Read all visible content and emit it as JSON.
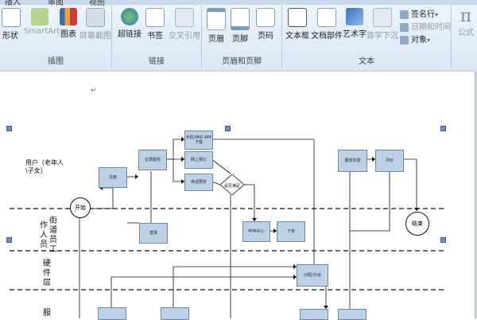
{
  "ribbon": {
    "tabs": [
      "插入",
      "审阅",
      "视图"
    ],
    "groups": [
      {
        "label": "插图"
      },
      {
        "label": "链接"
      },
      {
        "label": "页眉和页脚"
      },
      {
        "label": "文本"
      }
    ],
    "buttons": {
      "shape": "形状",
      "smartart": "SmartArt",
      "chart": "图表",
      "screenshot": "屏幕截图",
      "hyperlink": "超链接",
      "bookmark": "书签",
      "crossref": "交叉引用",
      "header": "页眉",
      "footer": "页脚",
      "pagenum": "页码",
      "textbox": "文本框",
      "docparts": "文档部件",
      "wordart": "艺术字",
      "dropcap": "首字下沉",
      "signature": "签名行",
      "datetime": "日期和时间",
      "object": "对象",
      "formula": "公式"
    },
    "dropdown_arrow": "▾"
  },
  "document": {
    "paragraph_mark": "↵",
    "lanes": {
      "user": "用户（老年人\\子女）",
      "street": "街\n道\n员\n工",
      "street_side": "作\n人\n员",
      "hardware": "硬\n件\n层",
      "service": "服"
    },
    "nodes": {
      "start": "开始",
      "end": "结束",
      "register": "注册",
      "login": "登录",
      "record": "记录服务",
      "pad": "手机/PAD APP下载",
      "web": "网上预订",
      "phone": "电话预定",
      "decision": "是否满足",
      "confirm": "确认",
      "call_center": "呼叫中心",
      "dispatch": "下单",
      "assign": "分配/分派",
      "feedback": "服务反馈",
      "evaluate": "评价"
    }
  },
  "colors": {
    "node_fill": "#bcd0e6",
    "node_border": "#6d87a8",
    "ribbon_bg": "#dbe6f4"
  }
}
